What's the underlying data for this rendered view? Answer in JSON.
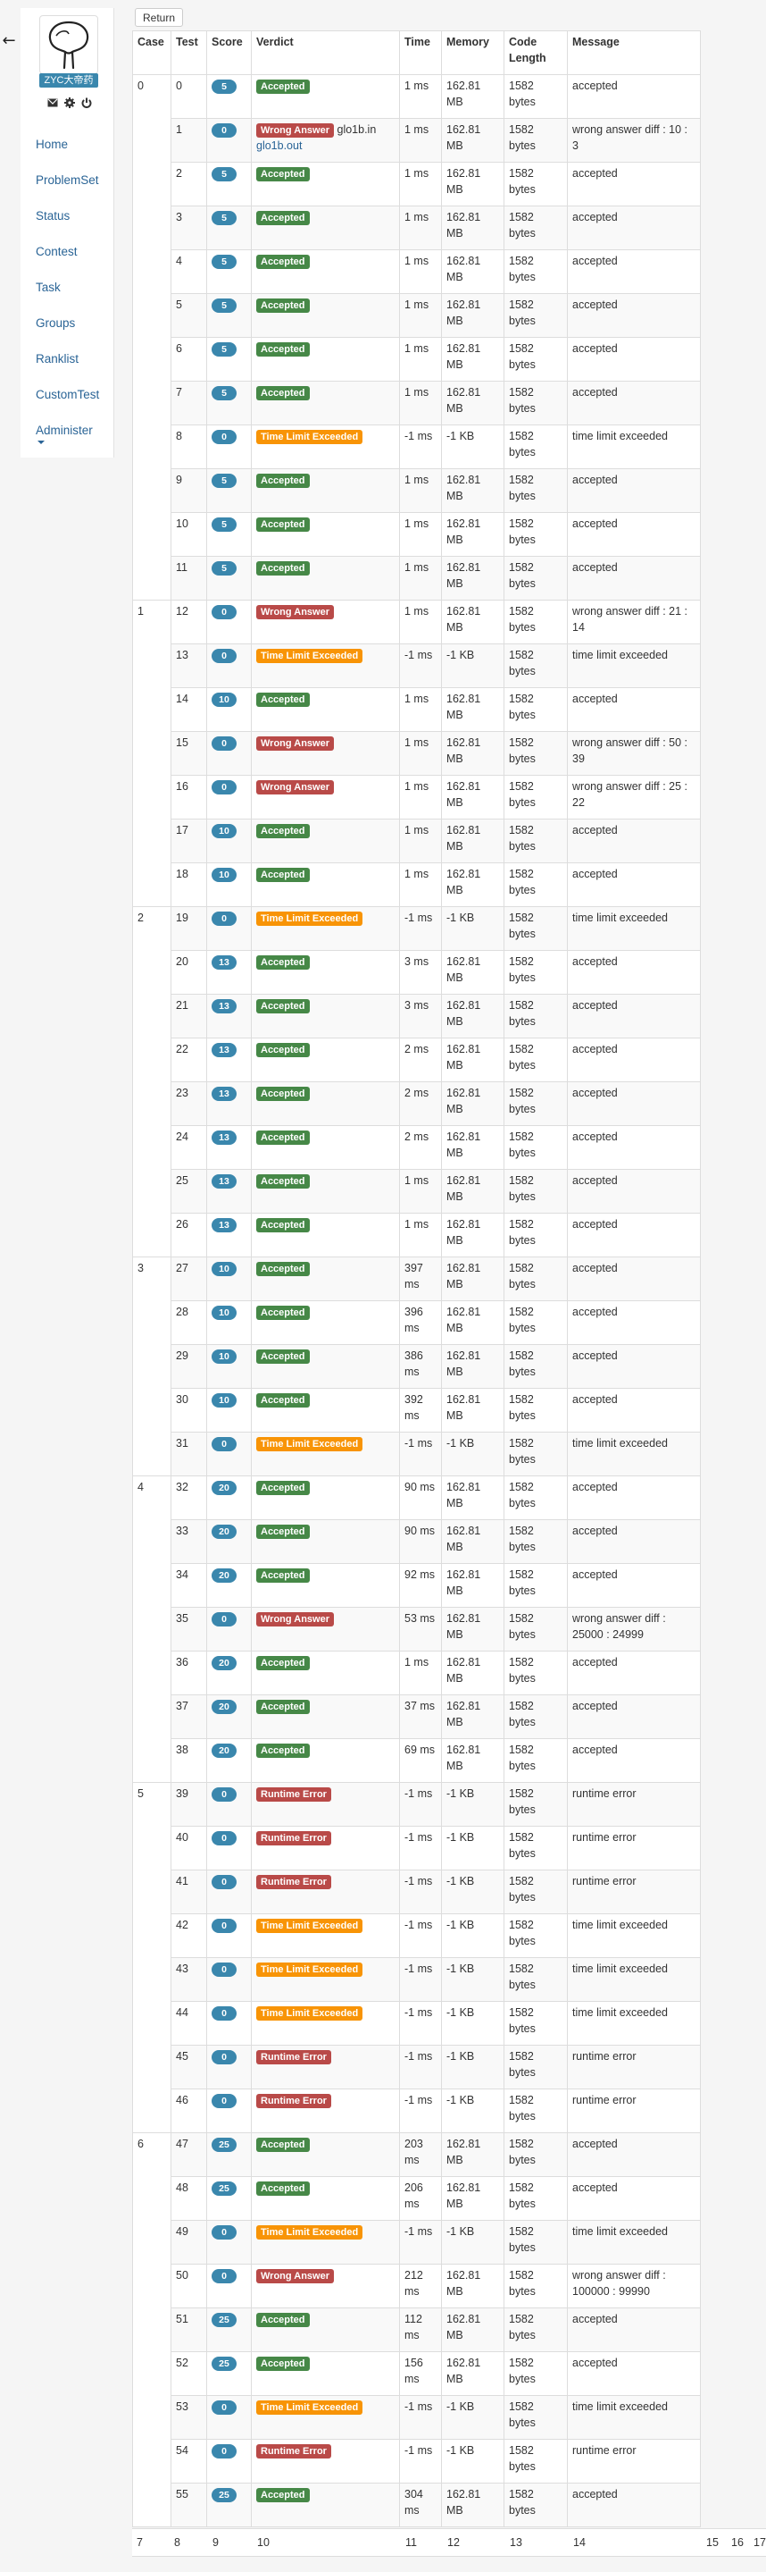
{
  "nav": {
    "username": "ZYC大帝药",
    "items": [
      "Home",
      "ProblemSet",
      "Status",
      "Contest",
      "Task",
      "Groups",
      "Ranklist",
      "CustomTest",
      "Administer"
    ]
  },
  "return_label": "Return",
  "table": {
    "headers": [
      "Case",
      "Test",
      "Score",
      "Verdict",
      "Time",
      "Memory",
      "Code Length",
      "Message"
    ],
    "groups": [
      {
        "case": "0",
        "rows": [
          {
            "test": "0",
            "score": "5",
            "verdict": "Accepted",
            "kind": "accepted",
            "time": "1 ms",
            "memory": "162.81 MB",
            "length": "1582 bytes",
            "message": "accepted"
          },
          {
            "test": "1",
            "score": "0",
            "verdict": "Wrong Answer",
            "kind": "wrong",
            "extra_file": "glo1b.in",
            "extra_link": "glo1b.out",
            "time": "1 ms",
            "memory": "162.81 MB",
            "length": "1582 bytes",
            "message": "wrong answer diff : 10 : 3"
          },
          {
            "test": "2",
            "score": "5",
            "verdict": "Accepted",
            "kind": "accepted",
            "time": "1 ms",
            "memory": "162.81 MB",
            "length": "1582 bytes",
            "message": "accepted"
          },
          {
            "test": "3",
            "score": "5",
            "verdict": "Accepted",
            "kind": "accepted",
            "time": "1 ms",
            "memory": "162.81 MB",
            "length": "1582 bytes",
            "message": "accepted"
          },
          {
            "test": "4",
            "score": "5",
            "verdict": "Accepted",
            "kind": "accepted",
            "time": "1 ms",
            "memory": "162.81 MB",
            "length": "1582 bytes",
            "message": "accepted"
          },
          {
            "test": "5",
            "score": "5",
            "verdict": "Accepted",
            "kind": "accepted",
            "time": "1 ms",
            "memory": "162.81 MB",
            "length": "1582 bytes",
            "message": "accepted"
          },
          {
            "test": "6",
            "score": "5",
            "verdict": "Accepted",
            "kind": "accepted",
            "time": "1 ms",
            "memory": "162.81 MB",
            "length": "1582 bytes",
            "message": "accepted"
          },
          {
            "test": "7",
            "score": "5",
            "verdict": "Accepted",
            "kind": "accepted",
            "time": "1 ms",
            "memory": "162.81 MB",
            "length": "1582 bytes",
            "message": "accepted"
          },
          {
            "test": "8",
            "score": "0",
            "verdict": "Time Limit Exceeded",
            "kind": "tle",
            "time": "-1 ms",
            "memory": "-1 KB",
            "length": "1582 bytes",
            "message": "time limit exceeded"
          },
          {
            "test": "9",
            "score": "5",
            "verdict": "Accepted",
            "kind": "accepted",
            "time": "1 ms",
            "memory": "162.81 MB",
            "length": "1582 bytes",
            "message": "accepted"
          },
          {
            "test": "10",
            "score": "5",
            "verdict": "Accepted",
            "kind": "accepted",
            "time": "1 ms",
            "memory": "162.81 MB",
            "length": "1582 bytes",
            "message": "accepted"
          },
          {
            "test": "11",
            "score": "5",
            "verdict": "Accepted",
            "kind": "accepted",
            "time": "1 ms",
            "memory": "162.81 MB",
            "length": "1582 bytes",
            "message": "accepted"
          }
        ]
      },
      {
        "case": "1",
        "rows": [
          {
            "test": "12",
            "score": "0",
            "verdict": "Wrong Answer",
            "kind": "wrong",
            "time": "1 ms",
            "memory": "162.81 MB",
            "length": "1582 bytes",
            "message": "wrong answer diff : 21 : 14"
          },
          {
            "test": "13",
            "score": "0",
            "verdict": "Time Limit Exceeded",
            "kind": "tle",
            "time": "-1 ms",
            "memory": "-1 KB",
            "length": "1582 bytes",
            "message": "time limit exceeded"
          },
          {
            "test": "14",
            "score": "10",
            "verdict": "Accepted",
            "kind": "accepted",
            "time": "1 ms",
            "memory": "162.81 MB",
            "length": "1582 bytes",
            "message": "accepted"
          },
          {
            "test": "15",
            "score": "0",
            "verdict": "Wrong Answer",
            "kind": "wrong",
            "time": "1 ms",
            "memory": "162.81 MB",
            "length": "1582 bytes",
            "message": "wrong answer diff : 50 : 39"
          },
          {
            "test": "16",
            "score": "0",
            "verdict": "Wrong Answer",
            "kind": "wrong",
            "time": "1 ms",
            "memory": "162.81 MB",
            "length": "1582 bytes",
            "message": "wrong answer diff : 25 : 22"
          },
          {
            "test": "17",
            "score": "10",
            "verdict": "Accepted",
            "kind": "accepted",
            "time": "1 ms",
            "memory": "162.81 MB",
            "length": "1582 bytes",
            "message": "accepted"
          },
          {
            "test": "18",
            "score": "10",
            "verdict": "Accepted",
            "kind": "accepted",
            "time": "1 ms",
            "memory": "162.81 MB",
            "length": "1582 bytes",
            "message": "accepted"
          }
        ]
      },
      {
        "case": "2",
        "rows": [
          {
            "test": "19",
            "score": "0",
            "verdict": "Time Limit Exceeded",
            "kind": "tle",
            "time": "-1 ms",
            "memory": "-1 KB",
            "length": "1582 bytes",
            "message": "time limit exceeded"
          },
          {
            "test": "20",
            "score": "13",
            "verdict": "Accepted",
            "kind": "accepted",
            "time": "3 ms",
            "memory": "162.81 MB",
            "length": "1582 bytes",
            "message": "accepted"
          },
          {
            "test": "21",
            "score": "13",
            "verdict": "Accepted",
            "kind": "accepted",
            "time": "3 ms",
            "memory": "162.81 MB",
            "length": "1582 bytes",
            "message": "accepted"
          },
          {
            "test": "22",
            "score": "13",
            "verdict": "Accepted",
            "kind": "accepted",
            "time": "2 ms",
            "memory": "162.81 MB",
            "length": "1582 bytes",
            "message": "accepted"
          },
          {
            "test": "23",
            "score": "13",
            "verdict": "Accepted",
            "kind": "accepted",
            "time": "2 ms",
            "memory": "162.81 MB",
            "length": "1582 bytes",
            "message": "accepted"
          },
          {
            "test": "24",
            "score": "13",
            "verdict": "Accepted",
            "kind": "accepted",
            "time": "2 ms",
            "memory": "162.81 MB",
            "length": "1582 bytes",
            "message": "accepted"
          },
          {
            "test": "25",
            "score": "13",
            "verdict": "Accepted",
            "kind": "accepted",
            "time": "1 ms",
            "memory": "162.81 MB",
            "length": "1582 bytes",
            "message": "accepted"
          },
          {
            "test": "26",
            "score": "13",
            "verdict": "Accepted",
            "kind": "accepted",
            "time": "1 ms",
            "memory": "162.81 MB",
            "length": "1582 bytes",
            "message": "accepted"
          }
        ]
      },
      {
        "case": "3",
        "rows": [
          {
            "test": "27",
            "score": "10",
            "verdict": "Accepted",
            "kind": "accepted",
            "time": "397 ms",
            "memory": "162.81 MB",
            "length": "1582 bytes",
            "message": "accepted"
          },
          {
            "test": "28",
            "score": "10",
            "verdict": "Accepted",
            "kind": "accepted",
            "time": "396 ms",
            "memory": "162.81 MB",
            "length": "1582 bytes",
            "message": "accepted"
          },
          {
            "test": "29",
            "score": "10",
            "verdict": "Accepted",
            "kind": "accepted",
            "time": "386 ms",
            "memory": "162.81 MB",
            "length": "1582 bytes",
            "message": "accepted"
          },
          {
            "test": "30",
            "score": "10",
            "verdict": "Accepted",
            "kind": "accepted",
            "time": "392 ms",
            "memory": "162.81 MB",
            "length": "1582 bytes",
            "message": "accepted"
          },
          {
            "test": "31",
            "score": "0",
            "verdict": "Time Limit Exceeded",
            "kind": "tle",
            "time": "-1 ms",
            "memory": "-1 KB",
            "length": "1582 bytes",
            "message": "time limit exceeded"
          }
        ]
      },
      {
        "case": "4",
        "rows": [
          {
            "test": "32",
            "score": "20",
            "verdict": "Accepted",
            "kind": "accepted",
            "time": "90 ms",
            "memory": "162.81 MB",
            "length": "1582 bytes",
            "message": "accepted"
          },
          {
            "test": "33",
            "score": "20",
            "verdict": "Accepted",
            "kind": "accepted",
            "time": "90 ms",
            "memory": "162.81 MB",
            "length": "1582 bytes",
            "message": "accepted"
          },
          {
            "test": "34",
            "score": "20",
            "verdict": "Accepted",
            "kind": "accepted",
            "time": "92 ms",
            "memory": "162.81 MB",
            "length": "1582 bytes",
            "message": "accepted"
          },
          {
            "test": "35",
            "score": "0",
            "verdict": "Wrong Answer",
            "kind": "wrong",
            "time": "53 ms",
            "memory": "162.81 MB",
            "length": "1582 bytes",
            "message": "wrong answer diff : 25000 : 24999"
          },
          {
            "test": "36",
            "score": "20",
            "verdict": "Accepted",
            "kind": "accepted",
            "time": "1 ms",
            "memory": "162.81 MB",
            "length": "1582 bytes",
            "message": "accepted"
          },
          {
            "test": "37",
            "score": "20",
            "verdict": "Accepted",
            "kind": "accepted",
            "time": "37 ms",
            "memory": "162.81 MB",
            "length": "1582 bytes",
            "message": "accepted"
          },
          {
            "test": "38",
            "score": "20",
            "verdict": "Accepted",
            "kind": "accepted",
            "time": "69 ms",
            "memory": "162.81 MB",
            "length": "1582 bytes",
            "message": "accepted"
          }
        ]
      },
      {
        "case": "5",
        "rows": [
          {
            "test": "39",
            "score": "0",
            "verdict": "Runtime Error",
            "kind": "re",
            "time": "-1 ms",
            "memory": "-1 KB",
            "length": "1582 bytes",
            "message": "runtime error"
          },
          {
            "test": "40",
            "score": "0",
            "verdict": "Runtime Error",
            "kind": "re",
            "time": "-1 ms",
            "memory": "-1 KB",
            "length": "1582 bytes",
            "message": "runtime error"
          },
          {
            "test": "41",
            "score": "0",
            "verdict": "Runtime Error",
            "kind": "re",
            "time": "-1 ms",
            "memory": "-1 KB",
            "length": "1582 bytes",
            "message": "runtime error"
          },
          {
            "test": "42",
            "score": "0",
            "verdict": "Time Limit Exceeded",
            "kind": "tle",
            "time": "-1 ms",
            "memory": "-1 KB",
            "length": "1582 bytes",
            "message": "time limit exceeded"
          },
          {
            "test": "43",
            "score": "0",
            "verdict": "Time Limit Exceeded",
            "kind": "tle",
            "time": "-1 ms",
            "memory": "-1 KB",
            "length": "1582 bytes",
            "message": "time limit exceeded"
          },
          {
            "test": "44",
            "score": "0",
            "verdict": "Time Limit Exceeded",
            "kind": "tle",
            "time": "-1 ms",
            "memory": "-1 KB",
            "length": "1582 bytes",
            "message": "time limit exceeded"
          },
          {
            "test": "45",
            "score": "0",
            "verdict": "Runtime Error",
            "kind": "re",
            "time": "-1 ms",
            "memory": "-1 KB",
            "length": "1582 bytes",
            "message": "runtime error"
          },
          {
            "test": "46",
            "score": "0",
            "verdict": "Runtime Error",
            "kind": "re",
            "time": "-1 ms",
            "memory": "-1 KB",
            "length": "1582 bytes",
            "message": "runtime error"
          }
        ]
      },
      {
        "case": "6",
        "rows": [
          {
            "test": "47",
            "score": "25",
            "verdict": "Accepted",
            "kind": "accepted",
            "time": "203 ms",
            "memory": "162.81 MB",
            "length": "1582 bytes",
            "message": "accepted"
          },
          {
            "test": "48",
            "score": "25",
            "verdict": "Accepted",
            "kind": "accepted",
            "time": "206 ms",
            "memory": "162.81 MB",
            "length": "1582 bytes",
            "message": "accepted"
          },
          {
            "test": "49",
            "score": "0",
            "verdict": "Time Limit Exceeded",
            "kind": "tle",
            "time": "-1 ms",
            "memory": "-1 KB",
            "length": "1582 bytes",
            "message": "time limit exceeded"
          },
          {
            "test": "50",
            "score": "0",
            "verdict": "Wrong Answer",
            "kind": "wrong",
            "time": "212 ms",
            "memory": "162.81 MB",
            "length": "1582 bytes",
            "message": "wrong answer diff : 100000 : 99990"
          },
          {
            "test": "51",
            "score": "25",
            "verdict": "Accepted",
            "kind": "accepted",
            "time": "112 ms",
            "memory": "162.81 MB",
            "length": "1582 bytes",
            "message": "accepted"
          },
          {
            "test": "52",
            "score": "25",
            "verdict": "Accepted",
            "kind": "accepted",
            "time": "156 ms",
            "memory": "162.81 MB",
            "length": "1582 bytes",
            "message": "accepted"
          },
          {
            "test": "53",
            "score": "0",
            "verdict": "Time Limit Exceeded",
            "kind": "tle",
            "time": "-1 ms",
            "memory": "-1 KB",
            "length": "1582 bytes",
            "message": "time limit exceeded"
          },
          {
            "test": "54",
            "score": "0",
            "verdict": "Runtime Error",
            "kind": "re",
            "time": "-1 ms",
            "memory": "-1 KB",
            "length": "1582 bytes",
            "message": "runtime error"
          },
          {
            "test": "55",
            "score": "25",
            "verdict": "Accepted",
            "kind": "accepted",
            "time": "304 ms",
            "memory": "162.81 MB",
            "length": "1582 bytes",
            "message": "accepted"
          }
        ]
      }
    ]
  },
  "footer_numbers": [
    "7",
    "8",
    "9",
    "10",
    "11",
    "12",
    "13",
    "14",
    "15",
    "16",
    "17"
  ]
}
